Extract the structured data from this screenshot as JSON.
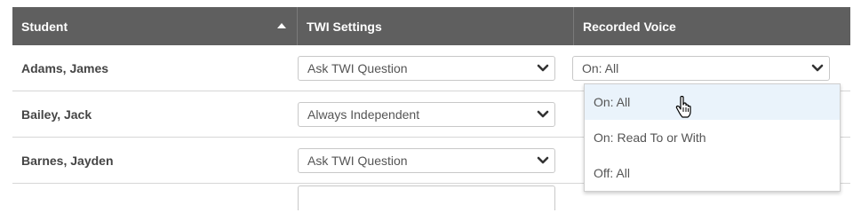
{
  "table": {
    "headers": {
      "student": "Student",
      "twi_settings": "TWI Settings",
      "recorded_voice": "Recorded Voice"
    },
    "rows": [
      {
        "student": "Adams, James",
        "twi": "Ask TWI Question",
        "voice": "On: All"
      },
      {
        "student": "Bailey, Jack",
        "twi": "Always Independent",
        "voice": ""
      },
      {
        "student": "Barnes, Jayden",
        "twi": "Ask TWI Question",
        "voice": ""
      }
    ]
  },
  "dropdown": {
    "options": [
      "On: All",
      "On: Read To or With",
      "Off: All"
    ],
    "highlighted_index": 0
  },
  "icons": {
    "sort": "sort-ascending-icon",
    "chevron": "chevron-down-icon",
    "cursor": "hand-pointer-icon"
  },
  "colors": {
    "header_bg": "#5f5f5f",
    "highlight": "#eaf3fb"
  }
}
